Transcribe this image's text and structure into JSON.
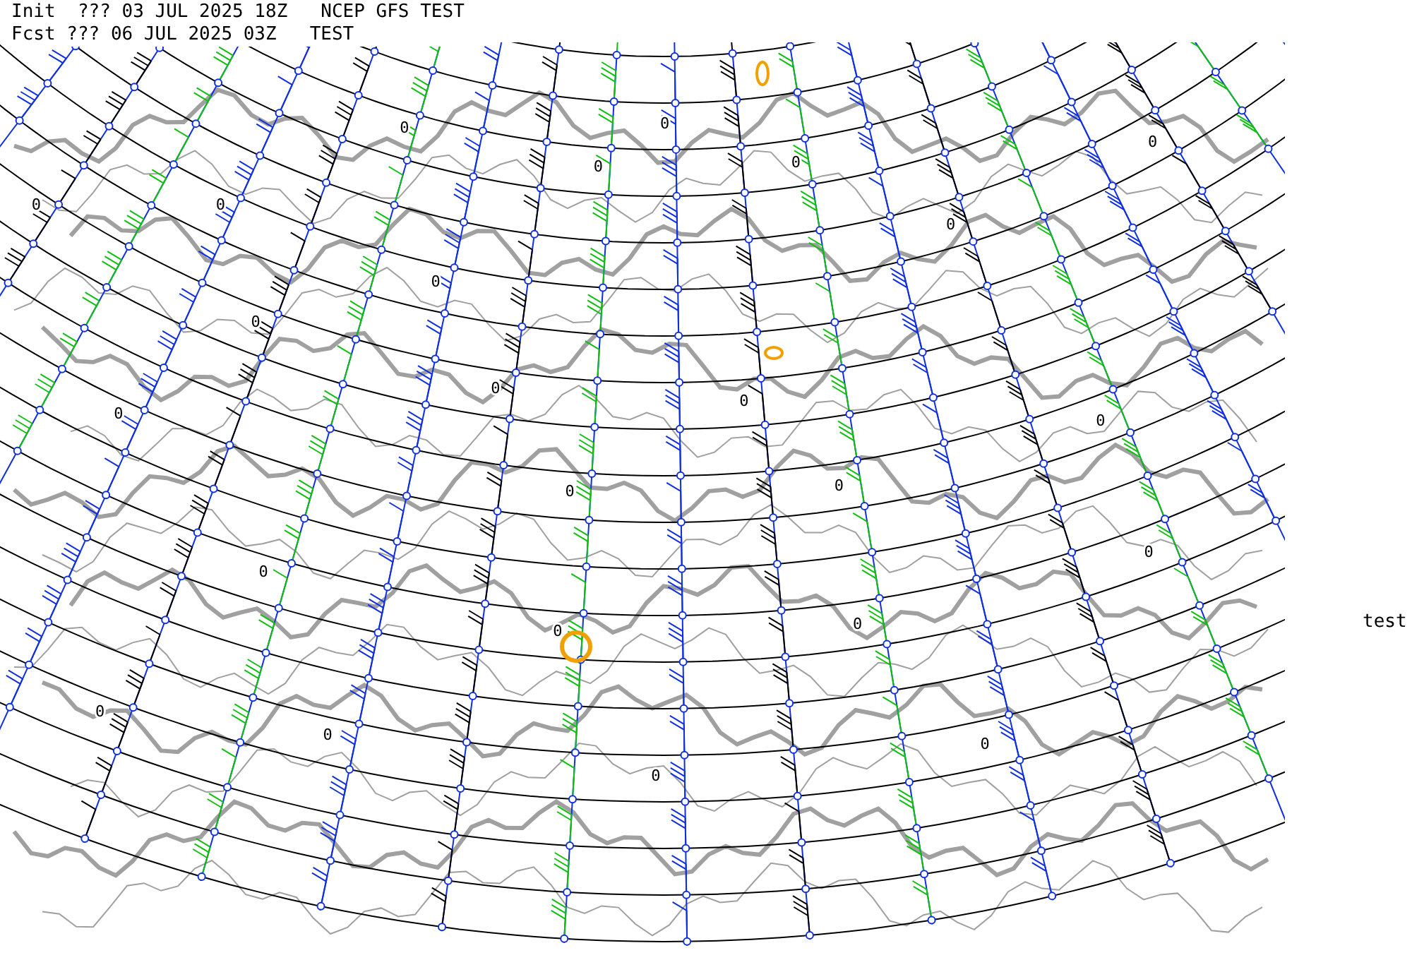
{
  "header": {
    "lines": [
      "Init  ??? 03 JUL 2025 18Z   NCEP GFS TEST",
      "Fcst ??? 06 JUL 2025 03Z   TEST"
    ]
  },
  "side_label": "test",
  "contour_labels": [
    "0",
    "0",
    "0",
    "0",
    "0",
    "0",
    "0",
    "0",
    "0",
    "0",
    "0",
    "0",
    "0",
    "0",
    "0",
    "0",
    "0",
    "0",
    "0",
    "0",
    "0",
    "0",
    "0",
    "0"
  ]
}
